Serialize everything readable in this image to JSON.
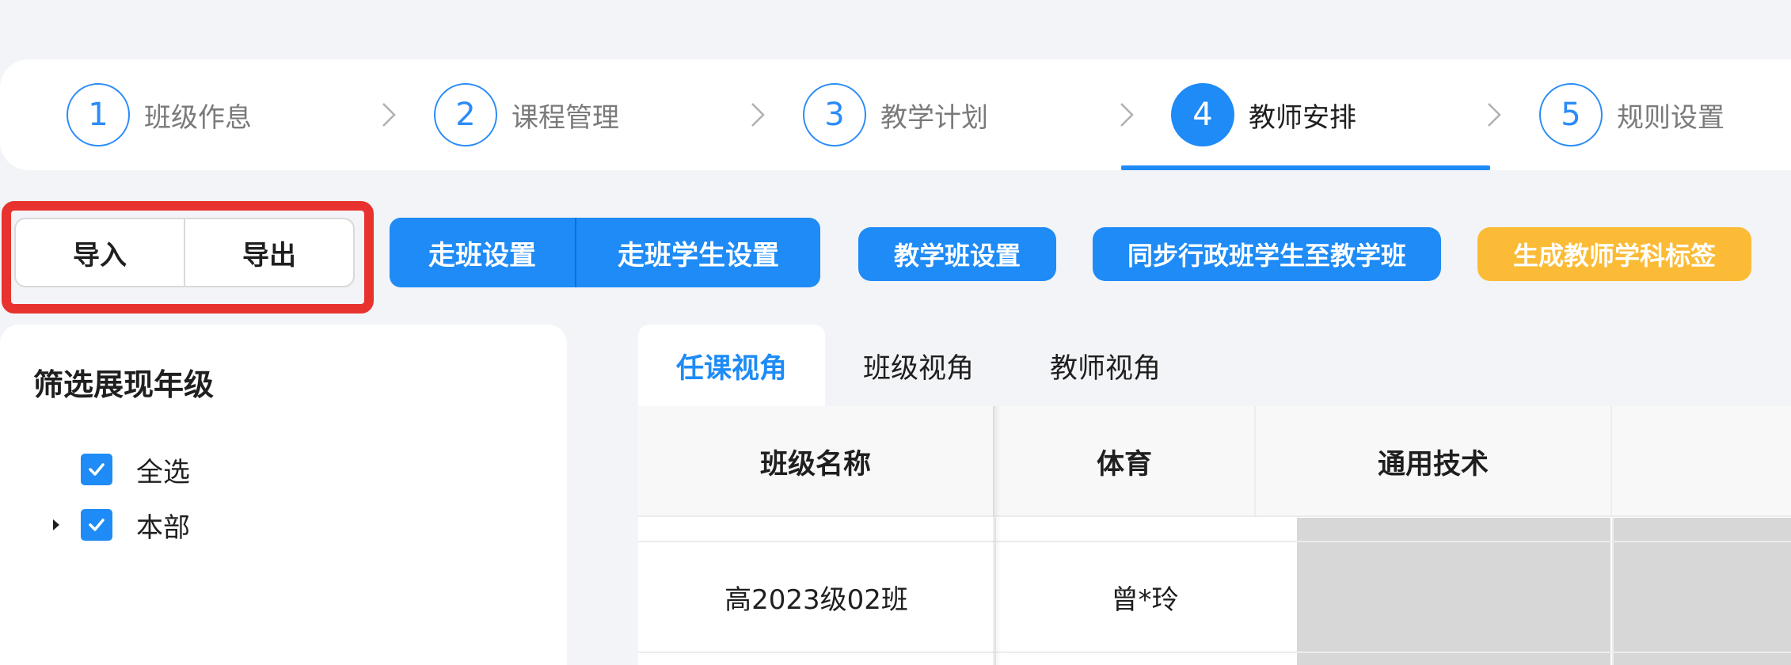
{
  "steps": [
    {
      "number": "1",
      "label": "班级作息"
    },
    {
      "number": "2",
      "label": "课程管理"
    },
    {
      "number": "3",
      "label": "教学计划"
    },
    {
      "number": "4",
      "label": "教师安排"
    },
    {
      "number": "5",
      "label": "规则设置"
    }
  ],
  "active_step": 4,
  "toolbar": {
    "import_label": "导入",
    "export_label": "导出",
    "walk_class_settings_label": "走班设置",
    "walk_class_student_settings_label": "走班学生设置",
    "teaching_class_settings_label": "教学班设置",
    "sync_students_label": "同步行政班学生至教学班",
    "generate_tags_label": "生成教师学科标签"
  },
  "filter": {
    "title": "筛选展现年级",
    "items": [
      {
        "label": "全选",
        "checked": true,
        "expandable": false
      },
      {
        "label": "本部",
        "checked": true,
        "expandable": true
      }
    ]
  },
  "tabs": [
    {
      "label": "任课视角",
      "active": true
    },
    {
      "label": "班级视角",
      "active": false
    },
    {
      "label": "教师视角",
      "active": false
    }
  ],
  "table": {
    "columns": [
      "班级名称",
      "体育",
      "通用技术"
    ],
    "rows": [
      {
        "class_name": "高2023级02班",
        "pe": "曾*玲",
        "general_tech": ""
      }
    ]
  },
  "colors": {
    "primary": "#1e8bf6",
    "warning": "#fbbb36",
    "highlight": "#e8322f"
  }
}
